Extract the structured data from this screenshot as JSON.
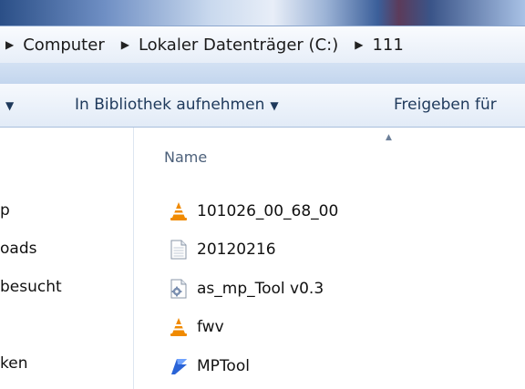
{
  "address": {
    "crumbs": [
      {
        "label": "Computer"
      },
      {
        "label": "Lokaler Datenträger (C:)"
      },
      {
        "label": "111"
      }
    ]
  },
  "toolbar": {
    "add_to_library": "In Bibliothek aufnehmen",
    "share_with": "Freigeben für"
  },
  "nav": {
    "items": [
      "p",
      "oads",
      "besucht",
      "ken"
    ]
  },
  "filelist": {
    "column_name": "Name",
    "files": [
      {
        "name": "101026_00_68_00",
        "icon": "vlc-icon"
      },
      {
        "name": "20120216",
        "icon": "text-file-icon"
      },
      {
        "name": "as_mp_Tool v0.3",
        "icon": "config-file-icon"
      },
      {
        "name": "fwv",
        "icon": "vlc-icon"
      },
      {
        "name": "MPTool",
        "icon": "mptool-app-icon"
      }
    ]
  },
  "colors": {
    "toolbar_text": "#1e395b",
    "header_text": "#4c607a",
    "vlc_orange": "#f08a00"
  }
}
